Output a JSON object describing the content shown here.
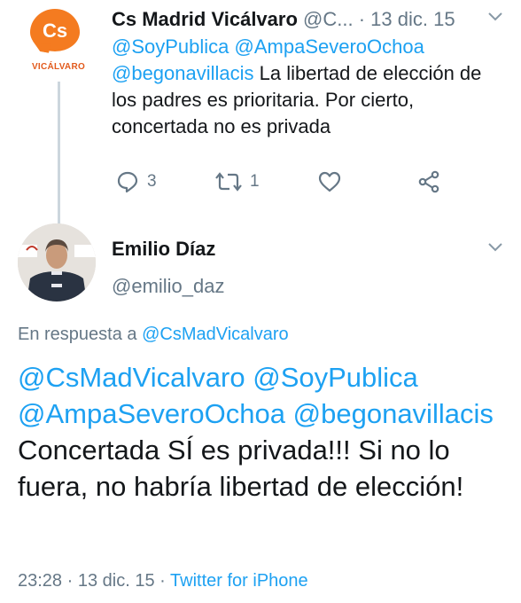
{
  "tweet1": {
    "display_name": "Cs Madrid Vicálvaro",
    "handle_truncated": "@C...",
    "dot": "·",
    "date": "13 dic. 15",
    "avatar_logo_text": "Cs",
    "avatar_caption": "VICÁLVARO",
    "mentions": [
      "@SoyPublica",
      "@AmpaSeveroOchoa",
      "@begonavillacis"
    ],
    "text": "La libertad de elección de los padres es prioritaria. Por cierto, concertada no es privada",
    "reply_count": "3",
    "retweet_count": "1"
  },
  "tweet2": {
    "display_name": "Emilio Díaz",
    "handle": "@emilio_daz",
    "reply_prefix": "En respuesta a",
    "reply_to": "@CsMadVicalvaro",
    "mentions": [
      "@CsMadVicalvaro",
      "@SoyPublica",
      "@AmpaSeveroOchoa",
      "@begonavillacis"
    ],
    "text": "Concertada SÍ es privada!!! Si no lo fuera, no habría libertad de elección!",
    "time": "23:28",
    "date": "13 dic. 15",
    "source": "Twitter for iPhone",
    "dot": "·"
  },
  "icons": {
    "reply": "reply-icon",
    "retweet": "retweet-icon",
    "like": "heart-icon",
    "share": "share-icon",
    "chevron": "chevron-down-icon"
  },
  "colors": {
    "link": "#1da1f2",
    "muted": "#657786",
    "brand_orange": "#f47b20"
  }
}
